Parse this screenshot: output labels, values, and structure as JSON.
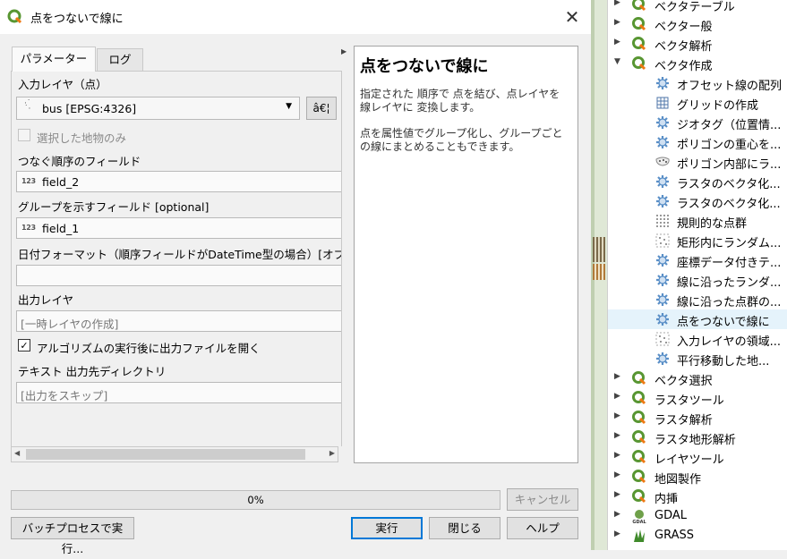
{
  "dialog": {
    "title": "点をつないで線に",
    "close_glyph": "✕",
    "tabs": [
      {
        "label": "パラメーター"
      },
      {
        "label": "ログ"
      }
    ],
    "input_layer": {
      "label": "入力レイヤ（点）",
      "value": "bus [EPSG:4326]",
      "side_button": "â€¦"
    },
    "selected_only": {
      "label": "選択した地物のみ",
      "checked": false
    },
    "order_field": {
      "label": "つなぐ順序のフィールド",
      "value": "field_2",
      "type_badge": "123"
    },
    "group_field": {
      "label": "グループを示すフィールド [optional]",
      "value": "field_1",
      "type_badge": "123"
    },
    "date_format": {
      "label": "日付フォーマット（順序フィールドがDateTime型の場合）[オプ",
      "value": ""
    },
    "output_layer": {
      "label": "出力レイヤ",
      "placeholder": "[一時レイヤの作成]"
    },
    "open_after": {
      "label": "アルゴリズムの実行後に出力ファイルを開く",
      "checked": true
    },
    "text_output_dir": {
      "label": "テキスト 出力先ディレクトリ",
      "placeholder": "[出力をスキップ]"
    },
    "help": {
      "title": "点をつないで線に",
      "paragraph1": "指定された 順序で 点を結び、点レイヤを 線レイヤに 変換します。",
      "paragraph2": "点を属性値でグループ化し、グループごとの線にまとめることもできます。"
    },
    "progress": {
      "label": "0%",
      "value": 0
    },
    "buttons": {
      "cancel": "キャンセル",
      "batch": "バッチプロセスで実行...",
      "run": "実行",
      "close": "閉じる",
      "help": "ヘルプ"
    }
  },
  "toolbox": {
    "items": [
      {
        "label": "ベクタテーブル",
        "icon": "qgis-icon",
        "expanded": false
      },
      {
        "label": "ベクター般",
        "icon": "qgis-icon",
        "expanded": false
      },
      {
        "label": "ベクタ解析",
        "icon": "qgis-icon",
        "expanded": false
      },
      {
        "label": "ベクタ作成",
        "icon": "qgis-icon",
        "expanded": true
      },
      {
        "label": "オフセット線の配列",
        "icon": "gear-icon"
      },
      {
        "label": "グリッドの作成",
        "icon": "grid-icon"
      },
      {
        "label": "ジオタグ（位置情...",
        "icon": "gear-icon"
      },
      {
        "label": "ポリゴンの重心を...",
        "icon": "gear-icon"
      },
      {
        "label": "ポリゴン内部にラ...",
        "icon": "random-points-icon"
      },
      {
        "label": "ラスタのベクタ化...",
        "icon": "gear-icon"
      },
      {
        "label": "ラスタのベクタ化...",
        "icon": "gear-icon"
      },
      {
        "label": "規則的な点群",
        "icon": "regular-points-icon"
      },
      {
        "label": "矩形内にランダム...",
        "icon": "random-extent-icon"
      },
      {
        "label": "座標データ付きテ...",
        "icon": "gear-icon"
      },
      {
        "label": "線に沿ったランダ...",
        "icon": "gear-icon"
      },
      {
        "label": "線に沿った点群の...",
        "icon": "gear-icon"
      },
      {
        "label": "点をつないで線に",
        "icon": "gear-icon",
        "selected": true
      },
      {
        "label": "入力レイヤの領域...",
        "icon": "random-extent-icon"
      },
      {
        "label": "平行移動した地...",
        "icon": "gear-icon"
      },
      {
        "label": "ベクタ選択",
        "icon": "qgis-icon",
        "expanded": false
      },
      {
        "label": "ラスタツール",
        "icon": "qgis-icon",
        "expanded": false
      },
      {
        "label": "ラスタ解析",
        "icon": "qgis-icon",
        "expanded": false
      },
      {
        "label": "ラスタ地形解析",
        "icon": "qgis-icon",
        "expanded": false
      },
      {
        "label": "レイヤツール",
        "icon": "qgis-icon",
        "expanded": false
      },
      {
        "label": "地図製作",
        "icon": "qgis-icon",
        "expanded": false
      },
      {
        "label": "内挿",
        "icon": "qgis-icon",
        "expanded": false
      },
      {
        "label": "GDAL",
        "icon": "gdal-icon",
        "expanded": false
      },
      {
        "label": "GRASS",
        "icon": "grass-icon",
        "expanded": false
      }
    ]
  }
}
